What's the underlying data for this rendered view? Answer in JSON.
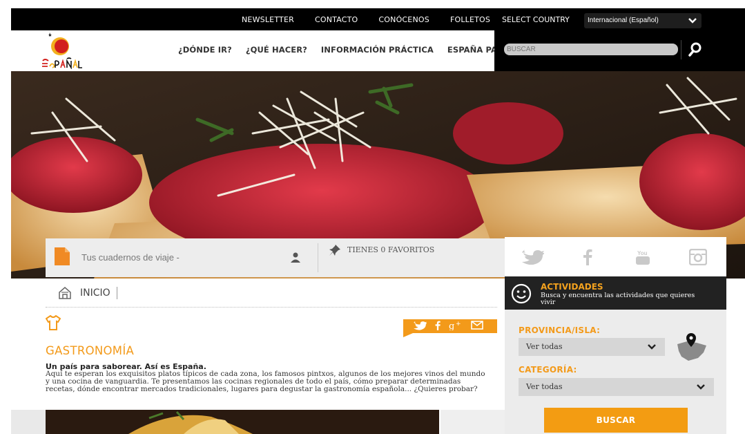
{
  "topbar": {
    "links": [
      "NEWSLETTER",
      "CONTACTO",
      "CONÓCENOS",
      "FOLLETOS"
    ],
    "select_country_label": "SELECT COUNTRY",
    "country_value": "Internacional (Español)"
  },
  "nav": {
    "items": [
      "¿DÓNDE IR?",
      "¿QUÉ HACER?",
      "INFORMACIÓN PRÁCTICA",
      "ESPAÑA PARA..."
    ]
  },
  "search": {
    "placeholder": "BUSCAR"
  },
  "cuadernos": {
    "label": "Tus cuadernos de viaje -",
    "favoritos": "TIENES 0 FAVORITOS"
  },
  "actividades": {
    "title": "ACTIVIDADES",
    "subtitle": "Busca y encuentra las actividades que quieres vivir"
  },
  "filters": {
    "provincia_label": "PROVINCIA/ISLA:",
    "provincia_value": "Ver todas",
    "categoria_label": "CATEGORÍA:",
    "categoria_value": "Ver todas",
    "submit": "BUSCAR"
  },
  "breadcrumb": {
    "home": "INICIO"
  },
  "article": {
    "title": "GASTRONOMÍA",
    "lead": "Un país para saborear. Así es España.",
    "body": "Aquí te esperan los exquisitos platos típicos de cada zona, los famosos pintxos, algunos de los mejores vinos del mundo y una cocina de vanguardia. Te presentamos las cocinas regionales de todo el país, cómo preparar determinadas recetas, dónde encontrar mercados tradicionales, lugares para degustar la gastronomía española... ¿Quieres probar?"
  },
  "colors": {
    "accent": "#f39a1a",
    "dark": "#000000"
  }
}
